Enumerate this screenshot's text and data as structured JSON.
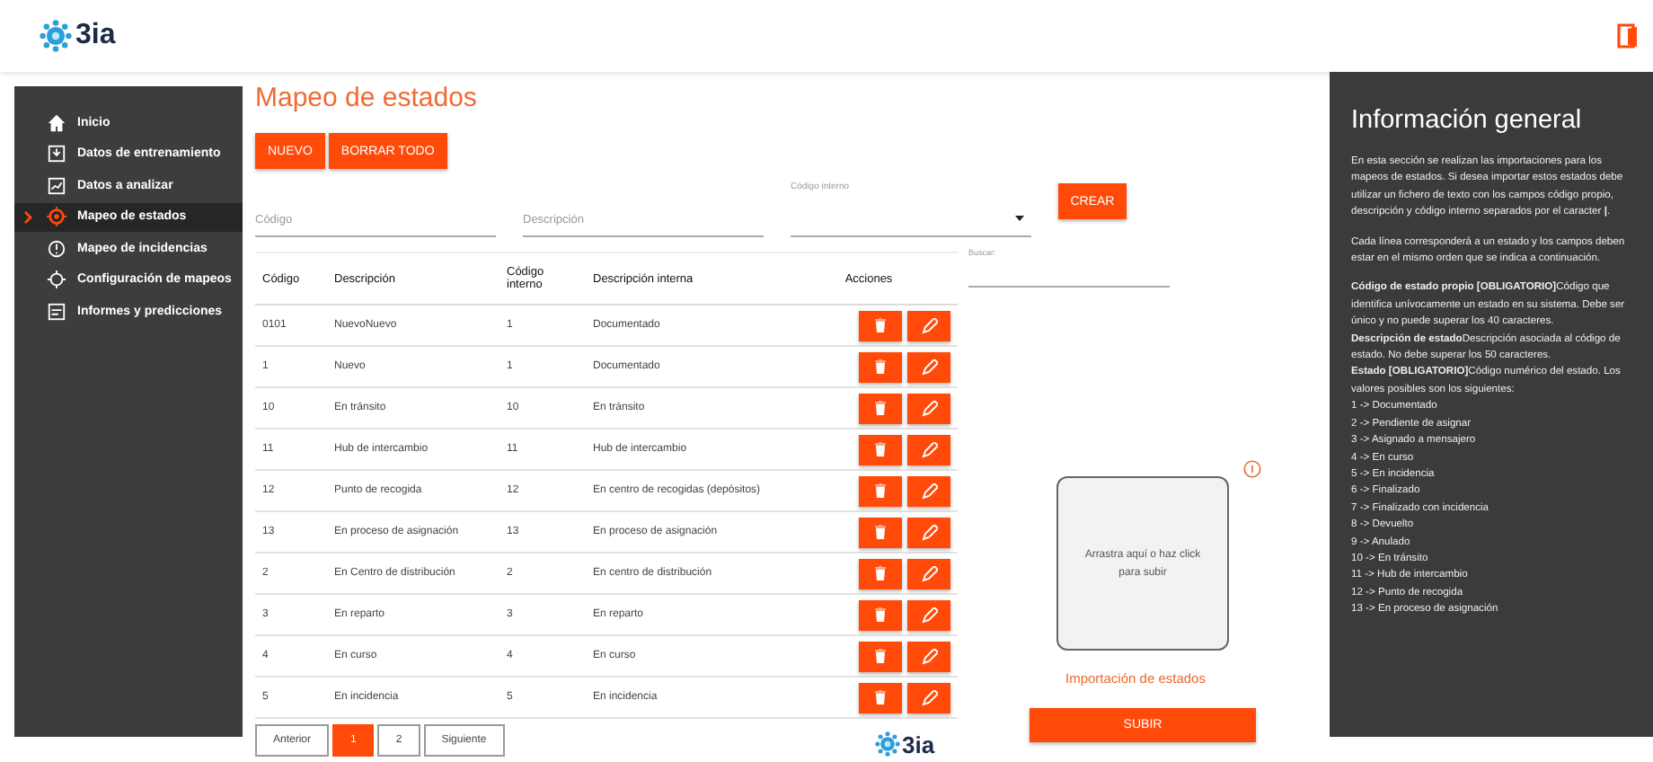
{
  "header": {
    "logo": "3ia"
  },
  "sidebar": {
    "items": [
      {
        "label": "Inicio",
        "selected": false
      },
      {
        "label": "Datos de entrenamiento",
        "selected": false
      },
      {
        "label": "Datos a analizar",
        "selected": false
      },
      {
        "label": "Mapeo de estados",
        "selected": true
      },
      {
        "label": "Mapeo de incidencias",
        "selected": false
      },
      {
        "label": "Configuración de mapeos",
        "selected": false
      },
      {
        "label": "Informes y predicciones",
        "selected": false
      }
    ]
  },
  "main": {
    "title": "Mapeo de estados",
    "buttons": [
      "NUEVO",
      "BORRAR TODO"
    ],
    "form": {
      "code": {
        "placeholder": "Código"
      },
      "description": {
        "placeholder": "Descripción"
      },
      "internal_code": {
        "label": "Código interno"
      },
      "create_button": "CREAR"
    },
    "search": {
      "label": "Buscar:"
    },
    "table": {
      "columns": [
        "Código",
        "Descripción",
        "Código interno",
        "Descripción interna",
        "Acciones"
      ],
      "rows": [
        [
          "0101",
          "NuevoNuevo",
          "1",
          "Documentado"
        ],
        [
          "1",
          "Nuevo",
          "1",
          "Documentado"
        ],
        [
          "10",
          "En tránsito",
          "10",
          "En tránsito"
        ],
        [
          "11",
          "Hub de intercambio",
          "11",
          "Hub de intercambio"
        ],
        [
          "12",
          "Punto de recogida",
          "12",
          "En centro de recogidas (depósitos)"
        ],
        [
          "13",
          "En proceso de asignación",
          "13",
          "En proceso de asignación"
        ],
        [
          "2",
          "En Centro de distribución",
          "2",
          "En centro de distribución"
        ],
        [
          "3",
          "En reparto",
          "3",
          "En reparto"
        ],
        [
          "4",
          "En curso",
          "4",
          "En curso"
        ],
        [
          "5",
          "En incidencia",
          "5",
          "En incidencia"
        ]
      ]
    },
    "pagination": {
      "previous": "Anterior",
      "pages": [
        {
          "label": "1",
          "selected": true
        },
        {
          "label": "2",
          "selected": false
        }
      ],
      "next": "Siguiente"
    },
    "upload": {
      "dropzone": "Arrastra aquí o haz click para subir",
      "caption": "Importación de estados",
      "button": "SUBIR"
    },
    "footer_logo": "3ia"
  },
  "info": {
    "title": "Información general",
    "paragraphs": [
      "En esta sección se realizan las importaciones para los mapeos de estados. Si desea importar estos estados debe utilizar un fichero de texto con los campos código propio, descripción y código interno separados por el caracter **|**.",
      "Cada línea corresponderá a un estado y los campos deben estar en el mismo orden que se indica a continuación."
    ],
    "fields": [
      "**Código de estado propio [OBLIGATORIO]**Código que identifica unívocamente un estado en su sistema. Debe ser único y no puede superar los 40 caracteres.",
      "**Descripción de estado**Descripción asociada al código de estado. No debe superar los 50 caracteres.",
      "**Estado [OBLIGATORIO]**Código numérico del estado. Los valores posibles son los siguientes:"
    ],
    "values": [
      "1 -> Documentado",
      "2 -> Pendiente de asignar",
      "3 -> Asignado a mensajero",
      "4 -> En curso",
      "5 -> En incidencia",
      "6 -> Finalizado",
      "7 -> Finalizado con incidencia",
      "8 -> Devuelto",
      "9 -> Anulado",
      "10 -> En tránsito",
      "11 -> Hub de intercambio",
      "12 -> Punto de recogida",
      "13 -> En proceso de asignación"
    ]
  }
}
